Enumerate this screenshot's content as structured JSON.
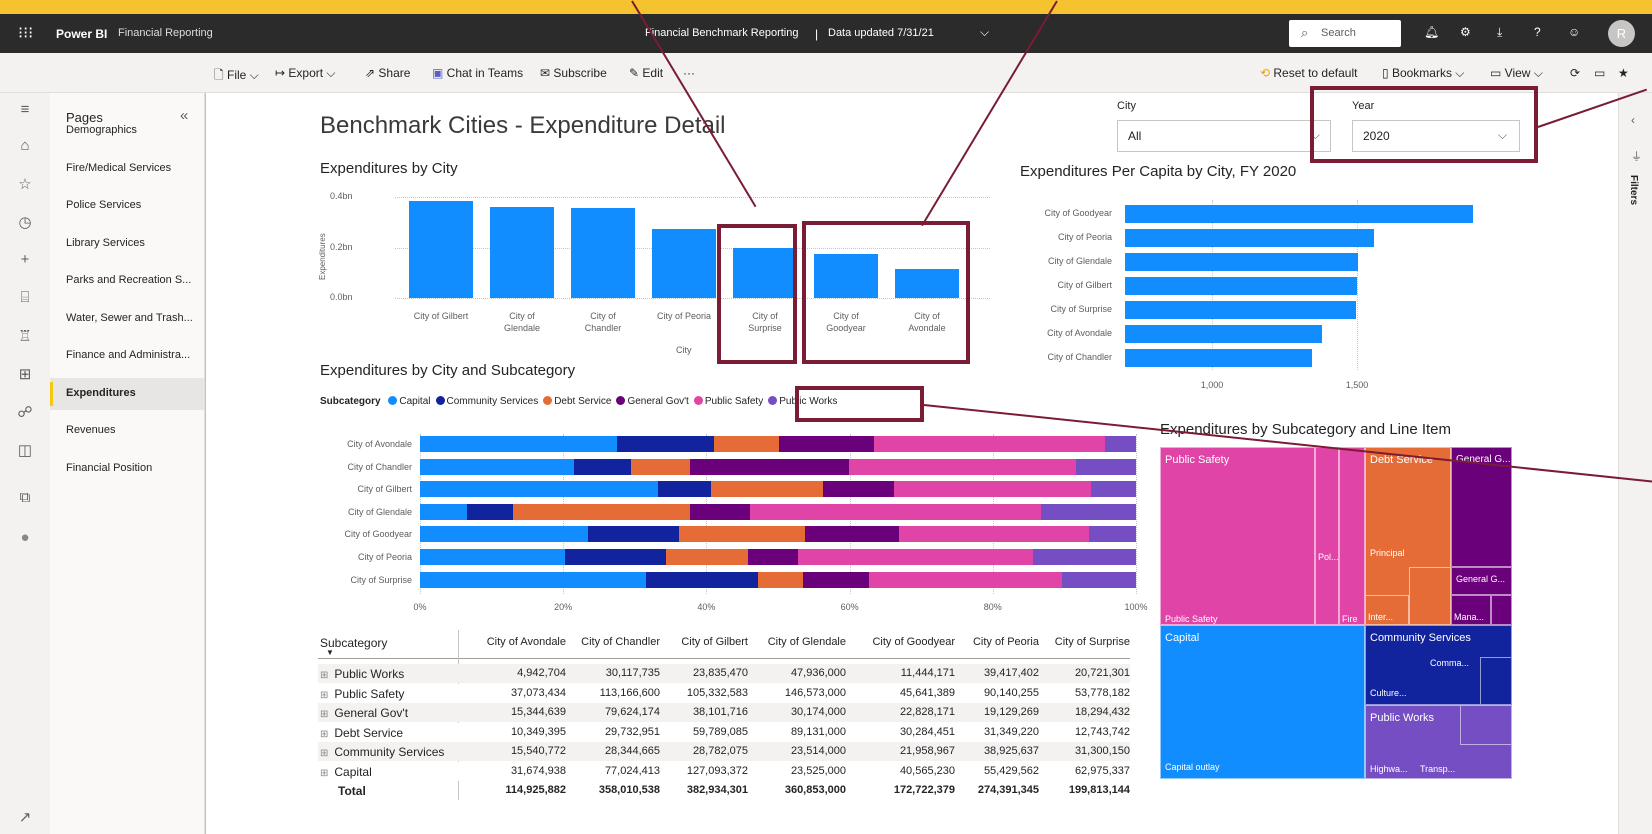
{
  "suite": {
    "app_name": "Power BI",
    "workspace": "Financial Reporting",
    "report_title": "Financial Benchmark Reporting",
    "separator": "|",
    "updated": "Data updated 7/31/21",
    "search_placeholder": "Search",
    "avatar_initial": "R"
  },
  "command_bar": {
    "file": "File",
    "export": "Export",
    "share": "Share",
    "chat": "Chat in Teams",
    "subscribe": "Subscribe",
    "edit": "Edit",
    "more": "···",
    "reset": "Reset to default",
    "bookmarks": "Bookmarks",
    "view": "View"
  },
  "pages_pane": {
    "title": "Pages",
    "items": [
      "Demographics",
      "Fire/Medical Services",
      "Police Services",
      "Library Services",
      "Parks and Recreation S...",
      "Water, Sewer and Trash...",
      "Finance and Administra...",
      "Expenditures",
      "Revenues",
      "Financial Position"
    ],
    "active_index": 7
  },
  "filters_label": "Filters",
  "report": {
    "title": "Benchmark Cities - Expenditure Detail",
    "city_slicer": {
      "label": "City",
      "value": "All"
    },
    "year_slicer": {
      "label": "Year",
      "value": "2020"
    }
  },
  "chart_data": [
    {
      "type": "bar",
      "title": "Expenditures by City",
      "xlabel": "City",
      "ylabel": "Expenditures",
      "categories": [
        "City of Gilbert",
        "City of Glendale",
        "City of Chandler",
        "City of Peoria",
        "City of Surprise",
        "City of Goodyear",
        "City of Avondale"
      ],
      "category_lines": [
        [
          "City of Gilbert"
        ],
        [
          "City of",
          "Glendale"
        ],
        [
          "City of",
          "Chandler"
        ],
        [
          "City of Peoria"
        ],
        [
          "City of",
          "Surprise"
        ],
        [
          "City of",
          "Goodyear"
        ],
        [
          "City of",
          "Avondale"
        ]
      ],
      "values": [
        0.383,
        0.361,
        0.358,
        0.274,
        0.2,
        0.173,
        0.115
      ],
      "ylim": [
        0,
        0.4
      ],
      "yticks": [
        {
          "v": 0.4,
          "label": "0.4bn"
        },
        {
          "v": 0.2,
          "label": "0.2bn"
        },
        {
          "v": 0,
          "label": "0.0bn"
        }
      ],
      "color": "#118dff"
    },
    {
      "type": "bar",
      "orientation": "horizontal",
      "title": "Expenditures Per Capita by City, FY 2020",
      "categories": [
        "City of Goodyear",
        "City of Peoria",
        "City of Glendale",
        "City of Gilbert",
        "City of Surprise",
        "City of Avondale",
        "City of Chandler"
      ],
      "values": [
        1900,
        1560,
        1505,
        1500,
        1495,
        1380,
        1345
      ],
      "xlim": [
        700,
        2000
      ],
      "xticks": [
        {
          "v": 1000,
          "label": "1,000"
        },
        {
          "v": 1500,
          "label": "1,500"
        }
      ],
      "color": "#118dff"
    },
    {
      "type": "bar",
      "orientation": "horizontal",
      "stacked": "100%",
      "title": "Expenditures by City and Subcategory",
      "legend_title": "Subcategory",
      "categories": [
        "City of Avondale",
        "City of Chandler",
        "City of Gilbert",
        "City of Glendale",
        "City of Goodyear",
        "City of Peoria",
        "City of Surprise"
      ],
      "series": [
        {
          "name": "Capital",
          "color": "#118dff",
          "values": [
            31674938,
            77024413,
            127093372,
            23525000,
            40565230,
            55429562,
            62975337
          ]
        },
        {
          "name": "Community Services",
          "color": "#12239e",
          "values": [
            15540772,
            28344665,
            28782075,
            23514000,
            21958967,
            38925637,
            31300150
          ]
        },
        {
          "name": "Debt Service",
          "color": "#e66c37",
          "values": [
            10349395,
            29732951,
            59789085,
            89131000,
            30284451,
            31349220,
            12743742
          ]
        },
        {
          "name": "General Gov't",
          "color": "#6b007b",
          "values": [
            15344639,
            79624174,
            38101716,
            30174000,
            22828171,
            19129269,
            18294432
          ]
        },
        {
          "name": "Public Safety",
          "color": "#e044a7",
          "values": [
            37073434,
            113166600,
            105332583,
            146573000,
            45641389,
            90140255,
            53778182
          ]
        },
        {
          "name": "Public Works",
          "color": "#744ec2",
          "values": [
            4942704,
            30117735,
            23835470,
            47936000,
            11444171,
            39417402,
            20721301
          ]
        }
      ],
      "xticks": [
        "0%",
        "20%",
        "40%",
        "60%",
        "80%",
        "100%"
      ]
    },
    {
      "type": "table",
      "columns": [
        "Subcategory",
        "City of Avondale",
        "City of Chandler",
        "City of Gilbert",
        "City of Glendale",
        "City of Goodyear",
        "City of Peoria",
        "City of Surprise"
      ],
      "rows": [
        [
          "Public Works",
          "4,942,704",
          "30,117,735",
          "23,835,470",
          "47,936,000",
          "11,444,171",
          "39,417,402",
          "20,721,301"
        ],
        [
          "Public Safety",
          "37,073,434",
          "113,166,600",
          "105,332,583",
          "146,573,000",
          "45,641,389",
          "90,140,255",
          "53,778,182"
        ],
        [
          "General Gov't",
          "15,344,639",
          "79,624,174",
          "38,101,716",
          "30,174,000",
          "22,828,171",
          "19,129,269",
          "18,294,432"
        ],
        [
          "Debt Service",
          "10,349,395",
          "29,732,951",
          "59,789,085",
          "89,131,000",
          "30,284,451",
          "31,349,220",
          "12,743,742"
        ],
        [
          "Community Services",
          "15,540,772",
          "28,344,665",
          "28,782,075",
          "23,514,000",
          "21,958,967",
          "38,925,637",
          "31,300,150"
        ],
        [
          "Capital",
          "31,674,938",
          "77,024,413",
          "127,093,372",
          "23,525,000",
          "40,565,230",
          "55,429,562",
          "62,975,337"
        ]
      ],
      "total": [
        "Total",
        "114,925,882",
        "358,010,538",
        "382,934,301",
        "360,853,000",
        "172,722,379",
        "274,391,345",
        "199,813,144"
      ]
    },
    {
      "type": "treemap",
      "title": "Expenditures by Subcategory and Line Item",
      "labels": {
        "public_safety": "Public Safety",
        "public_safety_inner": "Public Safety",
        "pol": "Pol...",
        "fire": "Fire",
        "debt_service": "Debt Service",
        "principal": "Principal",
        "inter": "Inter...",
        "general": "General G...",
        "general_inner": "General G...",
        "mana": "Mana...",
        "capital": "Capital",
        "capital_outlay": "Capital outlay",
        "community": "Community Services",
        "comma": "Comma...",
        "culture": "Culture...",
        "public_works": "Public Works",
        "highwa": "Highwa...",
        "transp": "Transp..."
      }
    }
  ]
}
